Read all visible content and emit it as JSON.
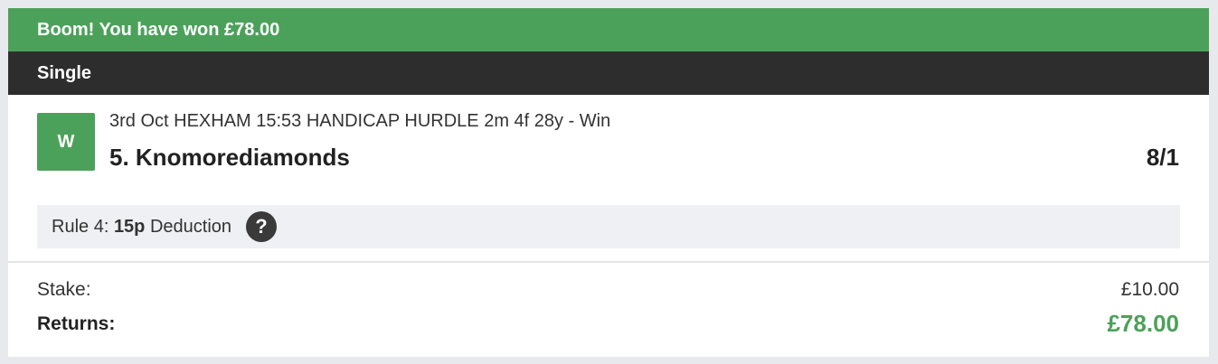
{
  "bet": {
    "banner_text": "Boom! You have won £78.00",
    "bet_type": "Single",
    "result_badge": "W",
    "event": "3rd Oct HEXHAM 15:53 HANDICAP HURDLE 2m 4f 28y - Win",
    "runner": "5. Knomorediamonds",
    "odds": "8/1",
    "rule4": {
      "prefix": "Rule 4: ",
      "amount": "15p",
      "suffix": " Deduction",
      "help_glyph": "?"
    },
    "stake_label": "Stake:",
    "stake_value": "£10.00",
    "returns_label": "Returns:",
    "returns_value": "£78.00"
  },
  "colors": {
    "win_green": "#4ca15a",
    "header_dark": "#2d2d2d",
    "rule4_bg": "#eef0f3",
    "page_bg": "#e8e9ec"
  },
  "icons": {
    "help": "help-icon"
  }
}
